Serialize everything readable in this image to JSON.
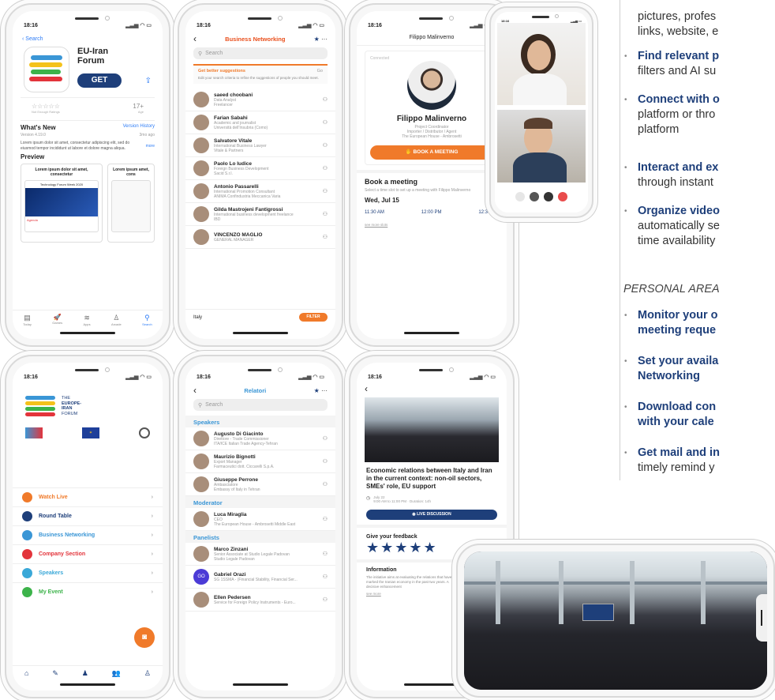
{
  "p1": {
    "time": "18:16",
    "back": "Search",
    "app_name": "EU-Iran Forum",
    "get": "GET",
    "rating_stars": "☆☆☆☆☆",
    "rating_caption": "Not Enough Ratings",
    "age": "17+",
    "age_caption": "Age",
    "whats_new": "What's New",
    "version_history": "Version History",
    "version": "Version 4.19.0",
    "ago": "3mo ago",
    "desc": "Lorem ipsum dolor sit amet, consectetur adipiscing elit, sed do eiusmod tempor incididunt ut labore et dolore magna aliqua.",
    "more": "more",
    "preview": "Preview",
    "prev1": "Lorem ipsum dolor sit amet, consectetur",
    "prev2": "Lorem ipsum amet, cons",
    "prev_title": "Technology Forum Week 2020",
    "agenda": "Agenda",
    "tabs": [
      {
        "label": "Today",
        "icon": "▤"
      },
      {
        "label": "Games",
        "icon": "🚀"
      },
      {
        "label": "Apps",
        "icon": "≋"
      },
      {
        "label": "Arcade",
        "icon": "♙"
      },
      {
        "label": "Search",
        "icon": "⚲"
      }
    ]
  },
  "p2": {
    "time": "18:16",
    "title": "Business Networking",
    "search": "Search",
    "sugg_title": "Get better suggestions",
    "sugg_action": "Go",
    "sugg_text": "Edit your search criteria to refine the suggestions of people you should meet.",
    "people": [
      {
        "name": "saeed choobani",
        "role": "Data Analyst",
        "org": "Freelancer"
      },
      {
        "name": "Farian Sabahi",
        "role": "Academic and journalist",
        "org": "Università dell'Insubria (Como)"
      },
      {
        "name": "Salvatore Vitale",
        "role": "International Business Lawyer",
        "org": "Vitale & Partners"
      },
      {
        "name": "Paolo Lo Iudice",
        "role": "Foreign Business Development",
        "org": "Sacid S.r.l."
      },
      {
        "name": "Antonio Passarelli",
        "role": "International Promotion Consultant",
        "org": "ANIMA Confindustria Meccanica Varia"
      },
      {
        "name": "Gilda Mastrojeni Fantigrossi",
        "role": "International business development freelance",
        "org": "IBD"
      },
      {
        "name": "VINCENZO MAGLIO",
        "role": "GENERAL MANAGER",
        "org": ""
      }
    ],
    "country": "Italy",
    "filter": "FILTER"
  },
  "p3": {
    "time": "18:16",
    "header": "Filippo Malinverno",
    "connected": "Connected",
    "name": "Filippo Malinverno",
    "role": "Project Coordinator",
    "type": "Importer / Distributor / Agent",
    "company": "The European House - Ambrosetti",
    "book_btn": "BOOK A MEETING",
    "book_title": "Book a meeting",
    "book_text": "Select a time slot to set up a meeting with Filippo Malinverno",
    "date": "Wed, Jul 15",
    "slots": [
      "11:30 AM",
      "12:00 PM",
      "12:30 PM"
    ],
    "more_slots": "see more slots"
  },
  "p4": {
    "time": "18:16"
  },
  "p5": {
    "time": "18:16",
    "logo_the": "THE",
    "logo_l1": "EUROPE-",
    "logo_l2": "IRAN",
    "logo_l3": "FORUM",
    "menu": [
      {
        "label": "Watch Live",
        "color": "#f07a2a"
      },
      {
        "label": "Round Table",
        "color": "#1e3f7a"
      },
      {
        "label": "Business Networking",
        "color": "#3a96d6"
      },
      {
        "label": "Company Section",
        "color": "#e3343b"
      },
      {
        "label": "Speakers",
        "color": "#3aa8d8"
      },
      {
        "label": "My Event",
        "color": "#3cb34a"
      }
    ]
  },
  "p6": {
    "time": "18:16",
    "title": "Relatori",
    "search": "Search",
    "speakers_h": "Speakers",
    "speakers": [
      {
        "name": "Augusto Di Giacinto",
        "role": "Direttore - Trade Commissioner",
        "org": "ITA/ICE Italian Trade Agency-Tehran"
      },
      {
        "name": "Maurizio Bignotti",
        "role": "Export Manager",
        "org": "Farmaceutici dott. Ciccarelli S.p.A."
      },
      {
        "name": "Giuseppe Perrone",
        "role": "Ambasciatore",
        "org": "Embassy of Italy in Tehran"
      }
    ],
    "moderator_h": "Moderator",
    "moderators": [
      {
        "name": "Luca Miraglia",
        "role": "CEO",
        "org": "The European House - Ambrosetti Middle East"
      }
    ],
    "panelists_h": "Panelists",
    "panelists": [
      {
        "name": "Marco Zinzani",
        "role": "Senior Associate at Studio Legale Padovan",
        "org": "Studio Legale Padovan"
      },
      {
        "name": "Gabriel Orazi",
        "role": "",
        "org": "SG 1SSMA - (Financial Stability, Financial Ser..."
      },
      {
        "name": "Ellen Pedersen",
        "role": "",
        "org": "Service for Foreign Policy Instruments - Euro..."
      }
    ],
    "go_initials": "GO"
  },
  "p7": {
    "time": "18:16",
    "title": "Economic relations between Italy and Iran in the current context: non-oil sectors, SMEs' role, EU support",
    "date": "July 22",
    "time_range": "9:00 AM to 11:00 PM · Duration: 14h",
    "live_btn": "LIVE DISCUSSION",
    "feedback": "Give your feedback",
    "stars": "★★★★★",
    "info_h": "Information",
    "info_text": "The initiative aims at evaluating the relations that have marked the Iranian economy in the past two years. A decisive enhancement",
    "see_more": "see more"
  },
  "right": {
    "l1": "pictures, profes",
    "l2": "links, website, e",
    "b1a": "Find relevant p",
    "b1b": "filters and AI su",
    "b2a": "Connect with o",
    "b2b": "platform or thro",
    "b2c": "platform",
    "b3a": "Interact and ex",
    "b3b": "through instant",
    "b4a": "Organize video",
    "b4b": "automatically se",
    "b4c": "time availability",
    "personal": "PERSONAL AREA",
    "c1a": "Monitor your o",
    "c1b": "meeting reque",
    "c2a": "Set your availa",
    "c2b": "Networking",
    "c3a": "Download con",
    "c3b": "with your cale",
    "c4a": "Get mail and in",
    "c4b": "timely remind y"
  },
  "colors": {
    "orange": "#f07a2a",
    "navy": "#1e3f7a",
    "blue": "#3a96d6"
  }
}
